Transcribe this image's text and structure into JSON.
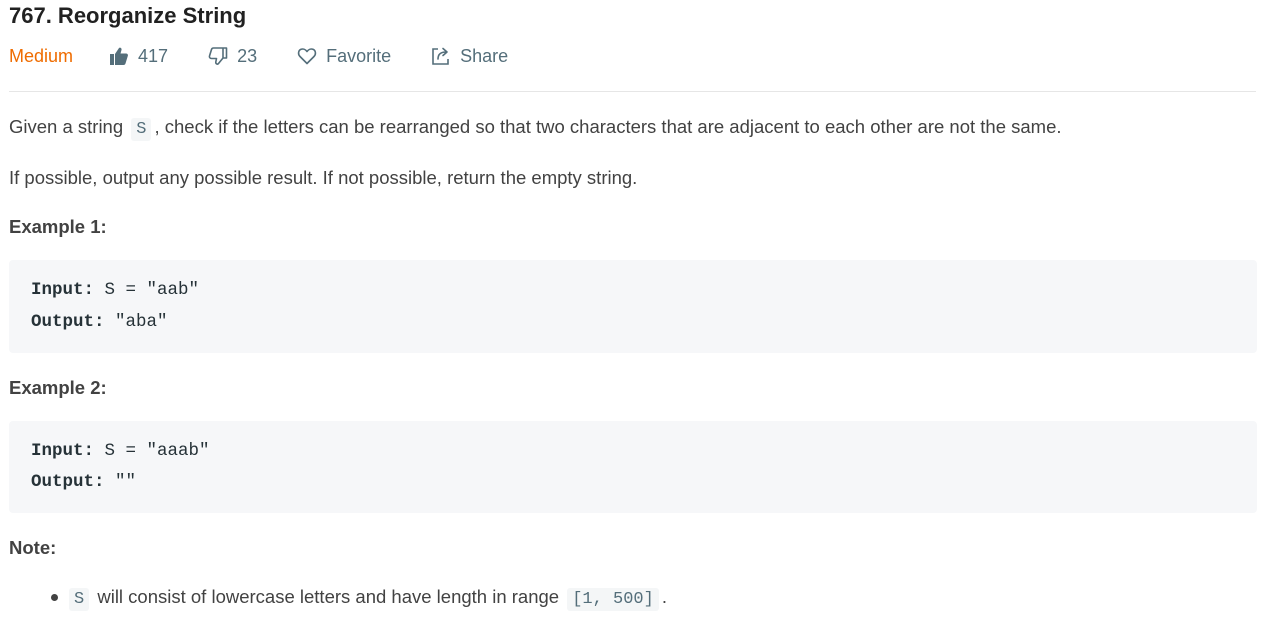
{
  "problem": {
    "title": "767. Reorganize String",
    "difficulty": "Medium",
    "likes": "417",
    "dislikes": "23",
    "favorite_label": "Favorite",
    "share_label": "Share"
  },
  "description": {
    "p1_before": "Given a string ",
    "p1_code": "S",
    "p1_after": ", check if the letters can be rearranged so that two characters that are adjacent to each other are not the same.",
    "p2": "If possible, output any possible result.  If not possible, return the empty string."
  },
  "examples": [
    {
      "title": "Example 1:",
      "input_label": "Input:",
      "input_value": " S = \"aab\"",
      "output_label": "Output:",
      "output_value": " \"aba\""
    },
    {
      "title": "Example 2:",
      "input_label": "Input:",
      "input_value": " S = \"aaab\"",
      "output_label": "Output:",
      "output_value": " \"\""
    }
  ],
  "note": {
    "title": "Note:",
    "items": [
      {
        "code_start": "S",
        "text": " will consist of lowercase letters and have length in range ",
        "code_range": "[1, 500]",
        "end": "."
      }
    ]
  },
  "colors": {
    "difficulty": "#ef6c00",
    "meta": "#546e7a",
    "text": "#424242",
    "code_bg": "#f6f7f9"
  },
  "icons": {
    "like": "thumbs-up-icon",
    "dislike": "thumbs-down-icon",
    "favorite": "heart-icon",
    "share": "share-icon"
  }
}
